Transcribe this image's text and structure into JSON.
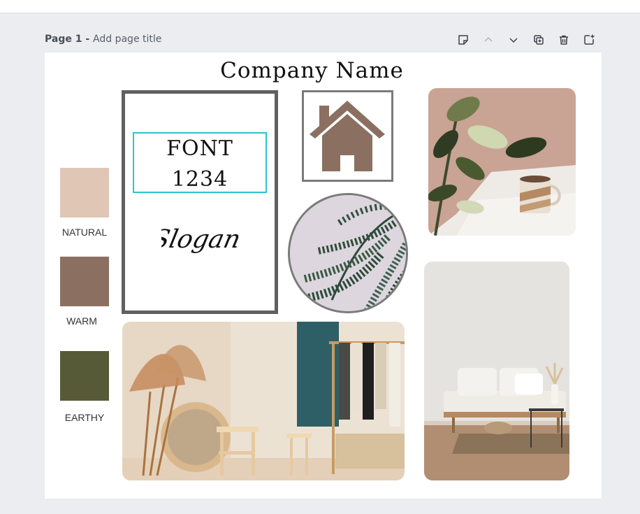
{
  "page": {
    "number_label": "Page 1",
    "separator": " - ",
    "title_placeholder": "Add page title"
  },
  "toolbar": {
    "icons": [
      "notes-icon",
      "chevron-up-icon",
      "chevron-down-icon",
      "duplicate-page-icon",
      "trash-icon",
      "add-page-icon"
    ]
  },
  "design": {
    "company_name": "Company Name",
    "font_sample": "FONT",
    "number_sample": "1234",
    "slogan": "Slogan",
    "swatches": [
      {
        "label": "NATURAL",
        "color": "#e0c6b4"
      },
      {
        "label": "WARM",
        "color": "#8b7062"
      },
      {
        "label": "EARTHY",
        "color": "#575a37"
      }
    ],
    "house_color": "#8b7062",
    "frame_color": "#606060",
    "highlight_color": "#2cc4cf"
  }
}
